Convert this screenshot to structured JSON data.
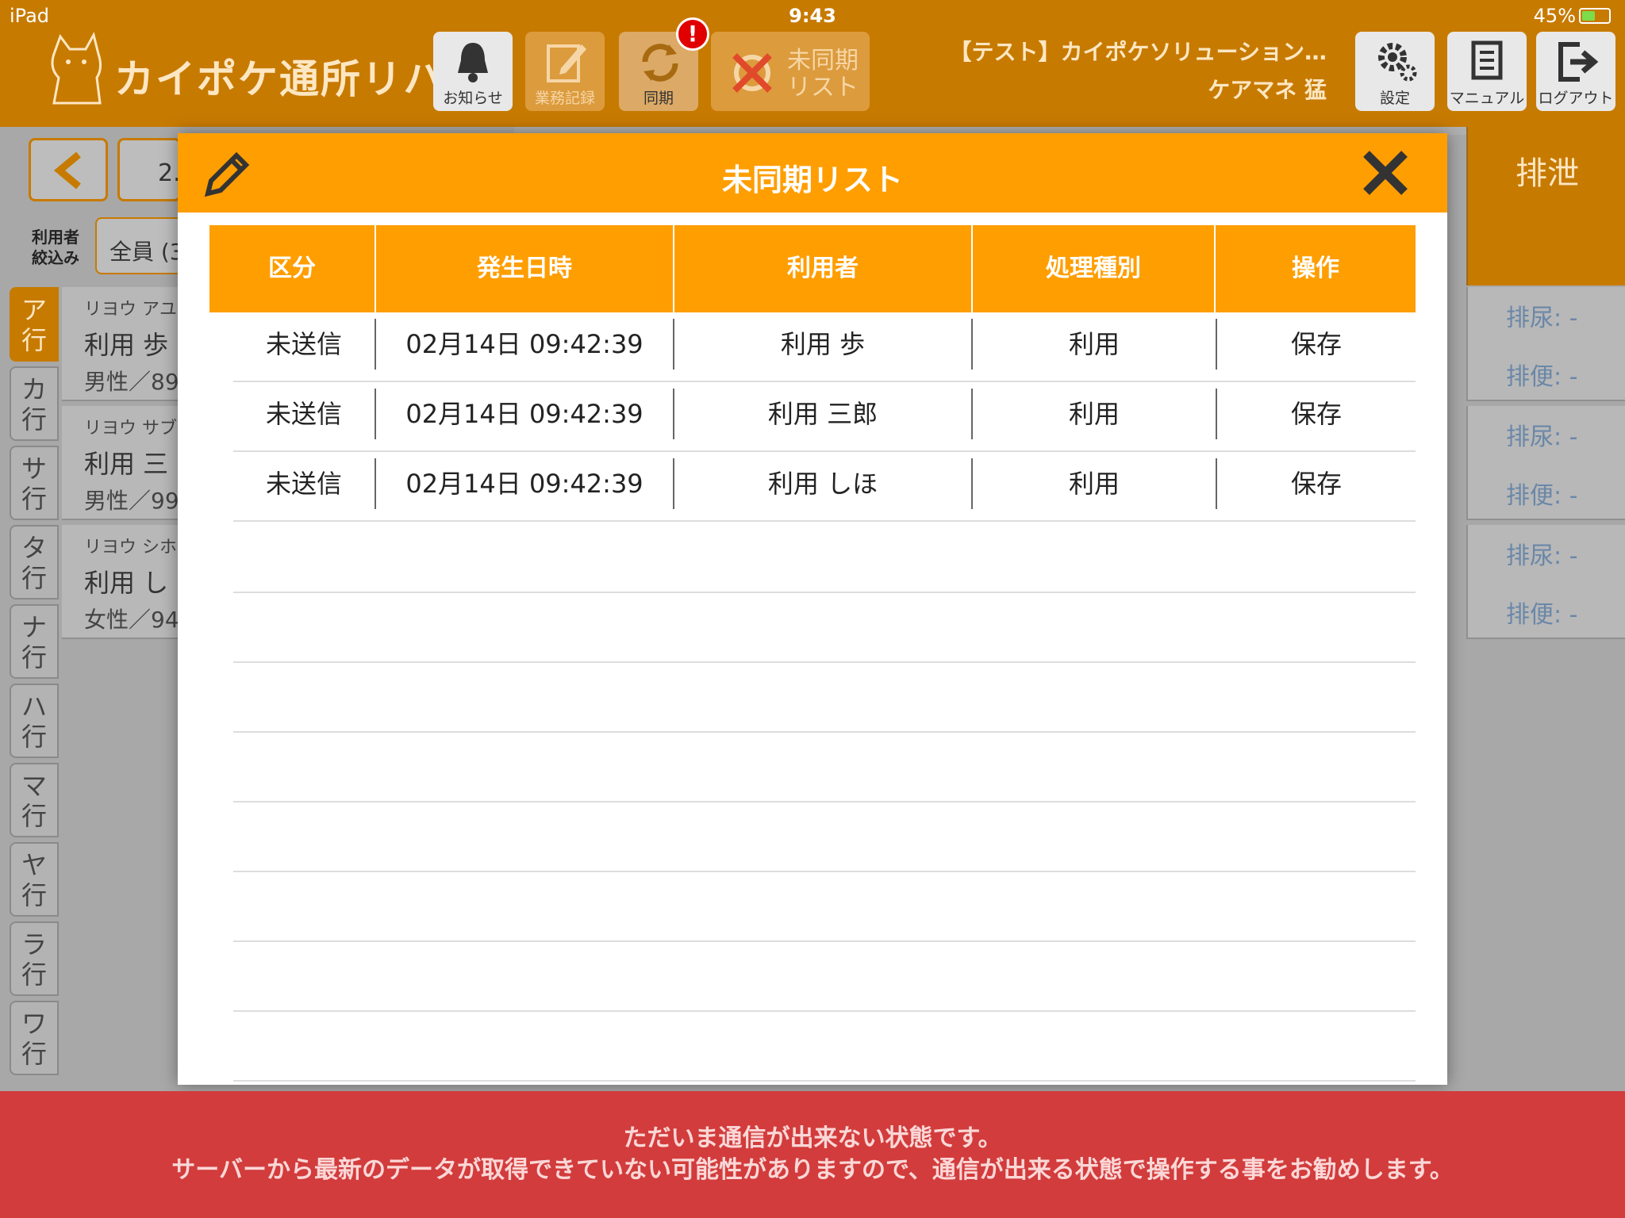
{
  "status_bar": {
    "device": "iPad",
    "time": "9:43",
    "battery": "45%"
  },
  "header": {
    "app_name": "カイポケ通所リハ",
    "buttons": {
      "notice": "お知らせ",
      "work_record": "業務記録",
      "sync": "同期",
      "unsync_list": "未同期 リスト",
      "settings": "設定",
      "manual": "マニュアル",
      "logout": "ログアウト"
    },
    "sync_badge": "!",
    "facility": "【テスト】カイポケソリューション…",
    "staff": "ケアマネ 猛"
  },
  "background": {
    "date_partial": "2.",
    "filter_label": "利用者 絞込み",
    "filter_value": "全員 (3",
    "kana_tabs": [
      {
        "top": "ア",
        "bottom": "行"
      },
      {
        "top": "カ",
        "bottom": "行"
      },
      {
        "top": "サ",
        "bottom": "行"
      },
      {
        "top": "タ",
        "bottom": "行"
      },
      {
        "top": "ナ",
        "bottom": "行"
      },
      {
        "top": "ハ",
        "bottom": "行"
      },
      {
        "top": "マ",
        "bottom": "行"
      },
      {
        "top": "ヤ",
        "bottom": "行"
      },
      {
        "top": "ラ",
        "bottom": "行"
      },
      {
        "top": "ワ",
        "bottom": "行"
      }
    ],
    "users": [
      {
        "kana": "リヨウ アユ",
        "name": "利用 歩",
        "meta": "男性／89"
      },
      {
        "kana": "リヨウ サブ",
        "name": "利用 三",
        "meta": "男性／99"
      },
      {
        "kana": "リヨウ シホ",
        "name": "利用 し",
        "meta": "女性／94"
      }
    ],
    "column_header": "排泄",
    "cells": [
      {
        "urine": "排尿: -",
        "stool": "排便: -"
      },
      {
        "urine": "排尿: -",
        "stool": "排便: -"
      },
      {
        "urine": "排尿: -",
        "stool": "排便: -"
      }
    ]
  },
  "modal": {
    "title": "未同期リスト",
    "columns": [
      "区分",
      "発生日時",
      "利用者",
      "処理種別",
      "操作"
    ],
    "rows": [
      {
        "category": "未送信",
        "datetime": "02月14日 09:42:39",
        "user": "利用 歩",
        "type": "利用",
        "action": "保存"
      },
      {
        "category": "未送信",
        "datetime": "02月14日 09:42:39",
        "user": "利用 三郎",
        "type": "利用",
        "action": "保存"
      },
      {
        "category": "未送信",
        "datetime": "02月14日 09:42:39",
        "user": "利用 しほ",
        "type": "利用",
        "action": "保存"
      }
    ]
  },
  "warning": {
    "line1": "ただいま通信が出来ない状態です。",
    "line2": "サーバーから最新のデータが取得できていない可能性がありますので、通信が出来る状態で操作する事をお勧めします。"
  },
  "colors": {
    "header": "#c77a00",
    "modal_accent": "#ff9e00",
    "warning": "#d23c3c"
  }
}
